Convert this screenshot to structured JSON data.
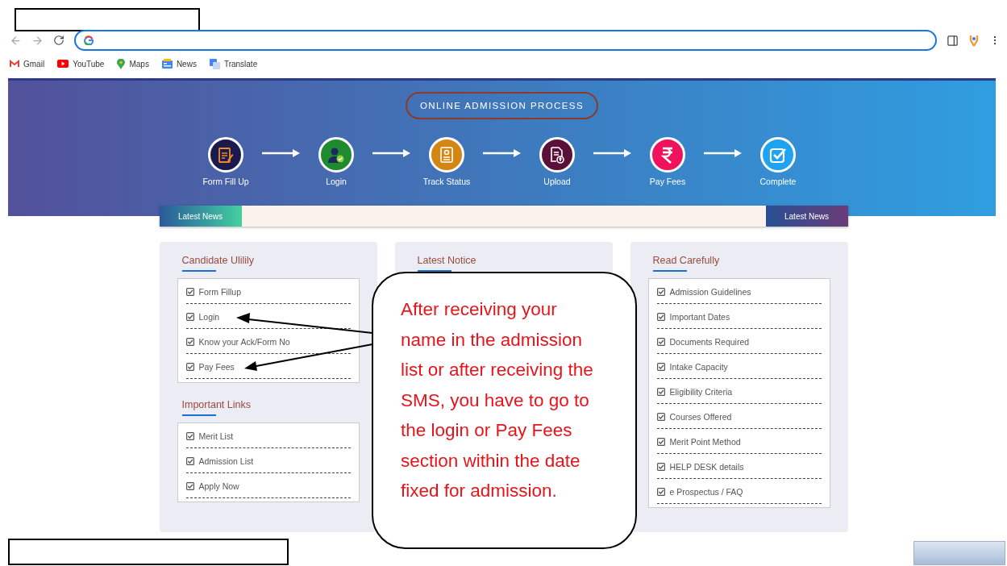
{
  "browser": {
    "bookmarks": [
      {
        "label": "Gmail",
        "kind": "gmail"
      },
      {
        "label": "YouTube",
        "kind": "youtube"
      },
      {
        "label": "Maps",
        "kind": "maps"
      },
      {
        "label": "News",
        "kind": "news"
      },
      {
        "label": "Translate",
        "kind": "translate"
      }
    ]
  },
  "banner": {
    "title": "ONLINE ADMISSION PROCESS",
    "steps": [
      {
        "label": "Form Fill Up",
        "color": "#1b1a4f",
        "kind": "form"
      },
      {
        "label": "Login",
        "color": "#1f8a30",
        "kind": "user"
      },
      {
        "label": "Track Status",
        "color": "#d48612",
        "kind": "badge"
      },
      {
        "label": "Upload",
        "color": "#5a1139",
        "kind": "upload"
      },
      {
        "label": "Pay Fees",
        "color": "#f0125c",
        "kind": "rupee"
      },
      {
        "label": "Complete",
        "color": "#1fa2f0",
        "kind": "check"
      }
    ]
  },
  "news_bar": {
    "left_label": "Latest News",
    "right_label": "Latest News"
  },
  "columns": [
    {
      "sections": [
        {
          "title": "Candidate Ulilily",
          "items": [
            "Form Fillup",
            "Login",
            "Know your Ack/Form No",
            "Pay Fees"
          ]
        },
        {
          "title": "Important Links",
          "items": [
            "Merit List",
            "Admission List",
            "Apply Now"
          ]
        }
      ]
    },
    {
      "sections": [
        {
          "title": "Latest Notice"
        }
      ]
    },
    {
      "sections": [
        {
          "title": "Read Carefully",
          "items": [
            "Admission Guidelines",
            "Important Dates",
            "Documents Required",
            "Intake Capacity",
            "Eligibility Criteria",
            "Courses Offered",
            "Merit Point Method",
            "HELP DESK details",
            "e Prospectus / FAQ"
          ]
        }
      ]
    }
  ],
  "callout": {
    "text": "After receiving your name in the admission list or after receiving the SMS, you have to go to the login or Pay Fees section within the date fixed for admission."
  }
}
